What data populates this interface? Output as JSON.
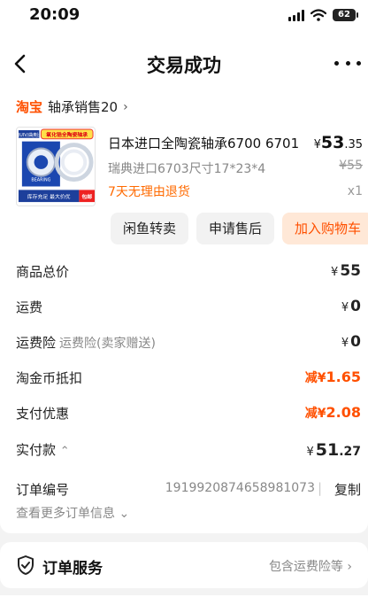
{
  "status_bar": {
    "time": "20:09",
    "battery": "62"
  },
  "nav": {
    "title": "交易成功"
  },
  "shop": {
    "platform": "淘宝",
    "name": "轴承销售20",
    "chevron": "›"
  },
  "product": {
    "title": "日本进口全陶瓷轴承6700 6701",
    "price_symbol": "¥",
    "price_int": "53",
    "price_dec": ".35",
    "sku": "瑞典进口6703尺寸17*23*4",
    "original_price": "¥55",
    "return_policy": "7天无理由退货",
    "quantity": "x1",
    "image_texts": {
      "brand": "QUIV/曲奥比",
      "badge": "氧化锆全陶瓷轴承",
      "bearing": "BEARING",
      "bottom": "库存充足 最大价优",
      "corner": "包邮"
    }
  },
  "actions": {
    "resell": "闲鱼转卖",
    "after_sale": "申请售后",
    "add_cart": "加入购物车"
  },
  "summary": {
    "total": {
      "label": "商品总价",
      "symbol": "¥",
      "value": "55"
    },
    "shipping": {
      "label": "运费",
      "symbol": "¥",
      "value": "0"
    },
    "insurance": {
      "label": "运费险",
      "sub": "运费险(卖家赠送)",
      "symbol": "¥",
      "value": "0"
    },
    "coins": {
      "label": "淘金币抵扣",
      "prefix": "减",
      "symbol": "¥",
      "value": "1.65"
    },
    "pay_discount": {
      "label": "支付优惠",
      "prefix": "减",
      "symbol": "¥",
      "value": "2.08"
    },
    "paid": {
      "label": "实付款",
      "toggle": "⌃",
      "symbol": "¥",
      "int": "51",
      "dec": ".27"
    }
  },
  "order": {
    "label": "订单编号",
    "number": "1919920874658981073",
    "separator": "|",
    "copy": "复制",
    "more": "查看更多订单信息 ⌄"
  },
  "service": {
    "title": "订单服务",
    "sub": "包含运费险等 ›"
  },
  "colors": {
    "accent": "#ff5000",
    "return_text": "#ff6a00",
    "cart_bg": "#ffe8d7"
  }
}
